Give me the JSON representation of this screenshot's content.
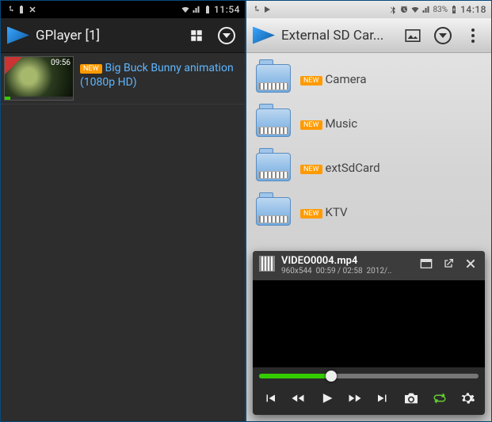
{
  "left": {
    "status": {
      "time": "11:54"
    },
    "app_title": "GPlayer [1]",
    "video": {
      "duration": "09:56",
      "new_label": "NEW",
      "title_line1": "Big Buck Bunny animation",
      "title_line2": "(1080p HD)"
    }
  },
  "right": {
    "status": {
      "battery_pct": "83%",
      "time": "14:18"
    },
    "app_title": "External SD Car...",
    "folders": [
      {
        "new_label": "NEW",
        "name": "Camera"
      },
      {
        "new_label": "NEW",
        "name": "Music"
      },
      {
        "new_label": "NEW",
        "name": "extSdCard"
      },
      {
        "new_label": "NEW",
        "name": "KTV"
      }
    ],
    "player": {
      "filename": "VIDEO0004.mp4",
      "resolution": "960x544",
      "time_current": "00:59",
      "time_total": "02:58",
      "date": "2012/.."
    }
  }
}
